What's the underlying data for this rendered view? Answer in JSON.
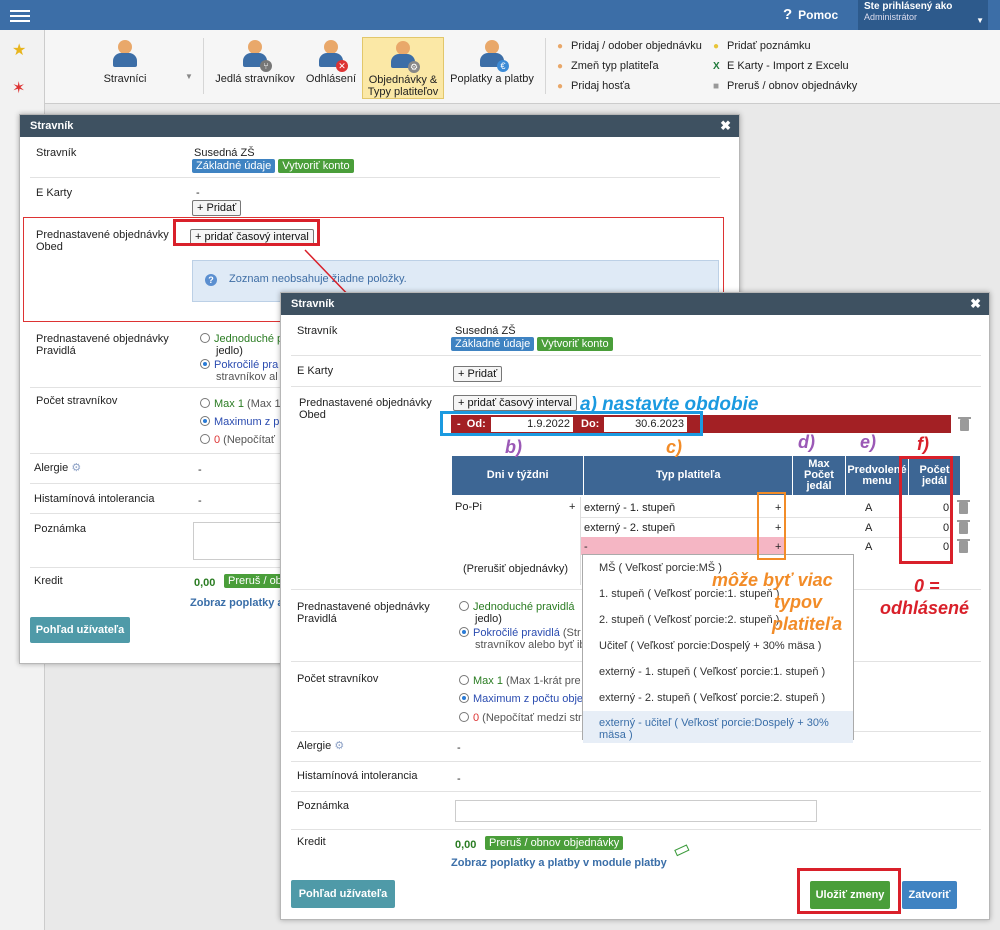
{
  "topbar": {
    "help": "Pomoc",
    "user_line1": "Ste prihlásený ako",
    "user_line2": "Administrátor"
  },
  "ribbon": {
    "buttons": [
      "Stravníci",
      "Jedlá stravníkov",
      "Odhlásení",
      "Objednávky & Typy platiteľov",
      "Poplatky a platby"
    ],
    "links": [
      "Pridaj / odober objednávku",
      "Zmeň typ platiteľa",
      "Pridaj hosťa",
      "Pridať poznámku",
      "E Karty - Import z Excelu",
      "Preruš / obnov objednávky"
    ]
  },
  "dlg1": {
    "title": "Stravník",
    "stravnik_label": "Stravník",
    "stravnik_value": "Susedná ZŠ",
    "btn_basic": "Základné údaje",
    "btn_account": "Vytvoriť konto",
    "ekarty_label": "E Karty",
    "ekarty_value": "-",
    "add": "+ Pridať",
    "preset_label": "Prednastavené objednávky Obed",
    "add_interval": "+ pridať časový interval",
    "empty_info": "Zoznam neobsahuje žiadne položky.",
    "rules_label": "Prednastavené objednávky Pravidlá",
    "rule1": "Jednoduché pra",
    "rule1b": "jedlo)",
    "rule2": "Pokročilé pra",
    "rule2b": "stravníkov al",
    "count_label": "Počet stravníkov",
    "count1": "Max 1",
    "count1b": " (Max 1",
    "count2": "Maximum z p",
    "count3": "0",
    "count3b": " (Nepočítať",
    "allergy": "Alergie",
    "hist": "Histamínová intolerancia",
    "dash": "-",
    "note": "Poznámka",
    "credit": "Kredit",
    "credit_val": "0,00",
    "credit_btn": "Preruš / ob",
    "fees_link": "Zobraz poplatky a",
    "user_view": "Pohľad užívateľa"
  },
  "dlg2": {
    "title": "Stravník",
    "stravnik_label": "Stravník",
    "stravnik_value": "Susedná ZŠ",
    "btn_basic": "Základné údaje",
    "btn_account": "Vytvoriť konto",
    "ekarty_label": "E Karty",
    "add": "+ Pridať",
    "preset_label": "Prednastavené objednávky Obed",
    "add_interval": "+ pridať časový interval",
    "od_label": "Od:",
    "od_value": "1.9.2022",
    "do_label": "Do:",
    "do_value": "30.6.2023",
    "minus": "-",
    "th": [
      "Dni v týždni",
      "Typ platiteľa",
      "Max Počet jedál",
      "Predvolené menu",
      "Počet jedál"
    ],
    "days": "Po-Pi",
    "plus": "+",
    "rows": [
      {
        "type": "externý - 1. stupeň",
        "menu": "A",
        "count": "0"
      },
      {
        "type": "externý - 2. stupeň",
        "menu": "A",
        "count": "0"
      },
      {
        "type": "-",
        "menu": "A",
        "count": "0"
      }
    ],
    "interrupt": "(Prerušiť objednávky)",
    "options": [
      "MŠ ( Veľkosť porcie:MŠ )",
      "1. stupeň ( Veľkosť porcie:1. stupeň )",
      "2. stupeň ( Veľkosť porcie:2. stupeň )",
      "Učiteľ ( Veľkosť porcie:Dospelý + 30% mäsa )",
      "externý - 1. stupeň ( Veľkosť porcie:1. stupeň )",
      "externý - 2. stupeň ( Veľkosť porcie:2. stupeň )",
      "externý - učiteľ ( Veľkosť porcie:Dospelý + 30% mäsa )"
    ],
    "rules_label": "Prednastavené objednávky Pravidlá",
    "rule1": "Jednoduché pravidlá",
    "rule1b": "jedlo)",
    "rule2": "Pokročilé pravidlá",
    "rule2x": " (Str",
    "rule2b": "stravníkov alebo byť ib",
    "count_label": "Počet stravníkov",
    "count1": "Max 1",
    "count1b": " (Max 1-krát pre",
    "count2": "Maximum z počtu obje",
    "count3": "0",
    "count3b": " (Nepočítať medzi str",
    "allergy": "Alergie",
    "hist": "Histamínová intolerancia",
    "dash": "-",
    "note": "Poznámka",
    "credit": "Kredit",
    "credit_val": "0,00",
    "credit_btn": "Preruš / obnov objednávky",
    "fees_link": "Zobraz poplatky a platby v module platby",
    "user_view": "Pohľad užívateľa",
    "save": "Uložiť zmeny",
    "close": "Zatvoriť"
  },
  "annotations": {
    "a": "a) nastavte obdobie",
    "b": "b)",
    "c": "c)",
    "d": "d)",
    "e": "e)",
    "f": "f)",
    "more1": "môže byť viac",
    "more2": "typov",
    "more3": "platiteľa",
    "zero1": "0 =",
    "zero2": "odhlásené"
  },
  "colors": {
    "topbar": "#3c6ea7",
    "red": "#d9202a",
    "blue_ann": "#1b9ae0",
    "purple_ann": "#9b59b6",
    "orange_ann": "#f28c28",
    "dark_red_band": "#a32024"
  }
}
